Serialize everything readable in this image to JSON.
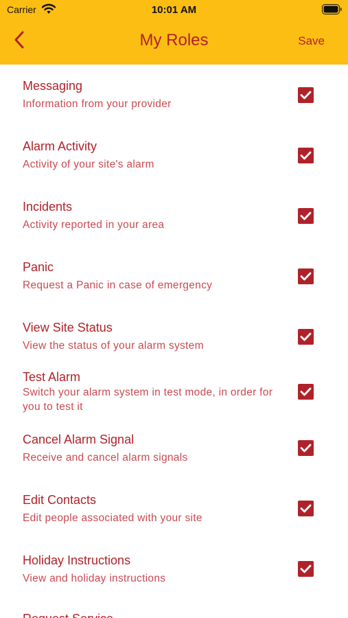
{
  "status_bar": {
    "carrier": "Carrier",
    "time": "10:01 AM"
  },
  "navbar": {
    "title": "My Roles",
    "save_label": "Save",
    "back_icon": "chevron-left-icon"
  },
  "colors": {
    "header_background": "#FDBE13",
    "accent": "#B0222A",
    "subtitle": "#C94A52"
  },
  "roles": [
    {
      "title": "Messaging",
      "subtitle": "Information from your provider",
      "checked": true
    },
    {
      "title": "Alarm Activity",
      "subtitle": "Activity of your site's alarm",
      "checked": true
    },
    {
      "title": "Incidents",
      "subtitle": "Activity reported in your area",
      "checked": true
    },
    {
      "title": "Panic",
      "subtitle": "Request a Panic in case of emergency",
      "checked": true
    },
    {
      "title": "View Site Status",
      "subtitle": "View the status of your alarm system",
      "checked": true
    },
    {
      "title": "Test Alarm",
      "subtitle": "Switch your alarm system in test mode,  in order for you to test it",
      "checked": true
    },
    {
      "title": "Cancel Alarm Signal",
      "subtitle": "Receive and cancel alarm signals",
      "checked": true
    },
    {
      "title": "Edit Contacts",
      "subtitle": "Edit people associated with your site",
      "checked": true
    },
    {
      "title": "Holiday Instructions",
      "subtitle": "View and holiday instructions",
      "checked": true
    },
    {
      "title": "Request Service",
      "subtitle": "",
      "checked": null
    }
  ]
}
